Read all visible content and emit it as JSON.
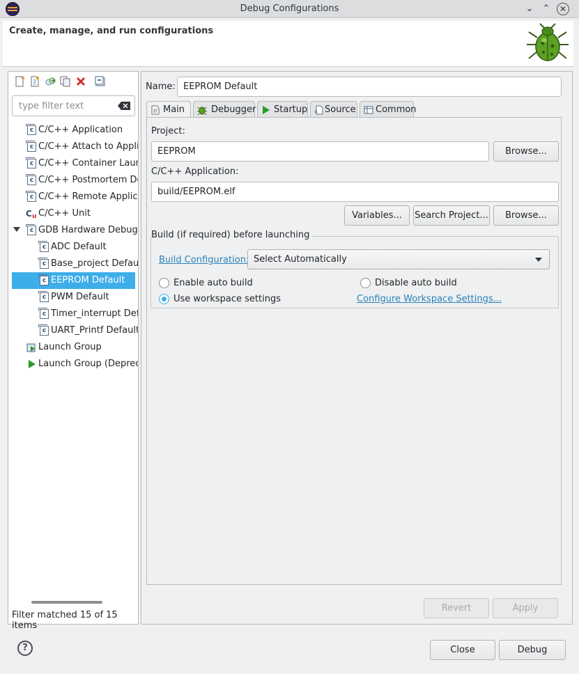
{
  "window": {
    "title": "Debug Configurations"
  },
  "header": {
    "heading": "Create, manage, and run configurations"
  },
  "left": {
    "filter_placeholder": "type filter text",
    "toolbar_icons": [
      "new-configuration-icon",
      "new-prototype-icon",
      "export-icon",
      "duplicate-icon",
      "delete-icon",
      "collapse-all-icon"
    ],
    "tree": [
      {
        "label": "C/C++ Application",
        "icon": "c-config-icon"
      },
      {
        "label": "C/C++ Attach to Applica",
        "icon": "c-config-icon"
      },
      {
        "label": "C/C++ Container Launch",
        "icon": "c-config-icon"
      },
      {
        "label": "C/C++ Postmortem Deb",
        "icon": "c-config-icon"
      },
      {
        "label": "C/C++ Remote Applicati",
        "icon": "c-config-icon"
      },
      {
        "label": "C/C++ Unit",
        "icon": "c-unit-icon"
      },
      {
        "label": "GDB Hardware Debugg",
        "icon": "c-config-icon"
      },
      {
        "label": "ADC Default",
        "icon": "c-config-icon"
      },
      {
        "label": "Base_project Default",
        "icon": "c-config-icon"
      },
      {
        "label": "EEPROM Default",
        "icon": "c-config-icon"
      },
      {
        "label": "PWM Default",
        "icon": "c-config-icon"
      },
      {
        "label": "Timer_interrupt Defa",
        "icon": "c-config-icon"
      },
      {
        "label": "UART_Printf Default",
        "icon": "c-config-icon"
      },
      {
        "label": "Launch Group",
        "icon": "launch-group-icon"
      },
      {
        "label": "Launch Group (Depreca",
        "icon": "launch-group-deprecated-icon"
      }
    ],
    "status": "Filter matched 15 of 15 items"
  },
  "right": {
    "name_label": "Name:",
    "name_value": "EEPROM Default",
    "tabs": [
      "Main",
      "Debugger",
      "Startup",
      "Source",
      "Common"
    ],
    "project_label": "Project:",
    "project_value": "EEPROM",
    "browse1": "Browse...",
    "app_label": "C/C++ Application:",
    "app_value": "build/EEPROM.elf",
    "variables": "Variables...",
    "search_project": "Search Project...",
    "browse2": "Browse...",
    "build_group": "Build (if required) before launching",
    "build_config_link": "Build Configuration:",
    "build_config_value": "Select Automatically",
    "enable_auto": "Enable auto build",
    "disable_auto": "Disable auto build",
    "use_workspace": "Use workspace settings",
    "configure_link": "Configure Workspace Settings...",
    "revert": "Revert",
    "apply": "Apply"
  },
  "footer": {
    "close": "Close",
    "debug": "Debug",
    "help": "?"
  }
}
